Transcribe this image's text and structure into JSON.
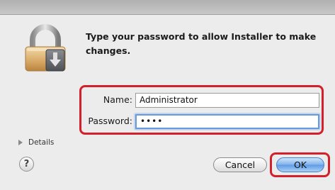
{
  "dialog": {
    "prompt": "Type your password to allow Installer to make changes."
  },
  "fields": {
    "name_label": "Name:",
    "name_value": "Administrator",
    "password_label": "Password:",
    "password_value": "••••"
  },
  "details": {
    "label": "Details"
  },
  "buttons": {
    "help_label": "?",
    "cancel_label": "Cancel",
    "ok_label": "OK"
  },
  "icons": {
    "lock": "lock-icon",
    "details_toggle": "disclosure-triangle-icon"
  },
  "colors": {
    "highlight": "#d41f2c",
    "default_button": "#6aa6ea",
    "focus_ring": "#6a9ad8"
  }
}
